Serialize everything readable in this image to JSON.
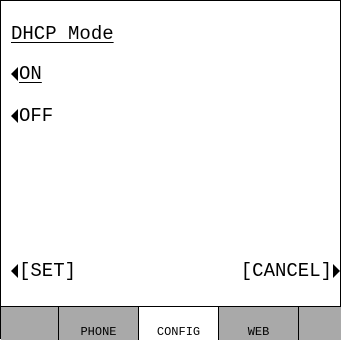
{
  "screen": {
    "title": "DHCP Mode",
    "options": [
      {
        "label": "ON",
        "selected": true
      },
      {
        "label": "OFF",
        "selected": false
      }
    ]
  },
  "softkeys": {
    "left": "[SET]",
    "right": "[CANCEL]"
  },
  "tabs": [
    {
      "label": ""
    },
    {
      "label": "PHONE"
    },
    {
      "label": "CONFIG",
      "active": true
    },
    {
      "label": "WEB"
    },
    {
      "label": ""
    }
  ],
  "colors": {
    "tab_inactive": "#a9a9a9",
    "tab_active": "#ffffff"
  }
}
